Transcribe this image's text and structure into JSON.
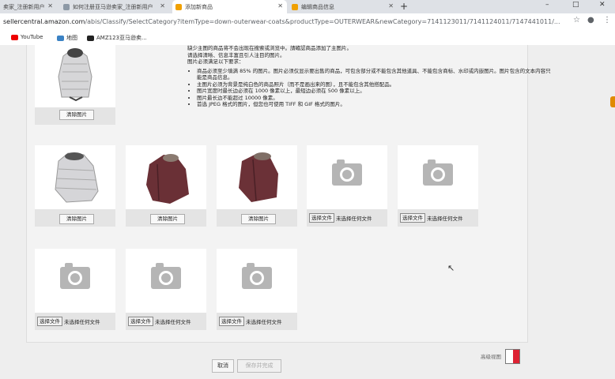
{
  "browser": {
    "tabs": [
      {
        "label": "卖家_注册新用户",
        "icon": "amazon-icon"
      },
      {
        "label": "如何注册亚马逊卖家_注册新用户",
        "icon": "doc-icon"
      },
      {
        "label": "添加新商品",
        "icon": "amazon-icon"
      },
      {
        "label": "编辑商品信息",
        "icon": "amazon-icon"
      }
    ],
    "new_tab": "+",
    "window_controls": {
      "minimize": "–",
      "maximize": "□",
      "close": "✕"
    },
    "url_host": "sellercentral.amazon.com",
    "url_path": "/abis/Classify/SelectCategory?itemType=down-outerwear-coats&productType=OUTERWEAR&newCategory=7141123011/7141124011/7147441011/..."
  },
  "bookmarks": [
    {
      "label": "YouTube",
      "icon": "youtube-icon"
    },
    {
      "label": "地图",
      "icon": "maps-icon"
    },
    {
      "label": "AMZ123亚马逊卖...",
      "icon": "amz123-icon"
    }
  ],
  "requirements": {
    "intro_lines": [
      "缺少主图的商品将不会出现在搜索或浏览中。請確認商品添加了主图片。",
      "请选择清晰、信息丰富且引人注目的图片。",
      "图片必须满足以下要求："
    ],
    "items": [
      "商品必须至少填满 85% 的图片。图片必须仅显示要出售的商品，可包含部分或不能包含其他道具、不能包含商标、水印或内嵌图片。图片包含的文本内容只能是商品信息。",
      "主图片必须为背景是纯白色的商品照片（而不是画出来的图），且不能包含其他搭配品。",
      "图片宽度时最长边必须在 1000 像素以上，最短边必须在 500 像素以上。",
      "图片最长边不能超过 10000 像素。",
      "首选 JPEG 格式的图片，但您也可使用 TIFF 和 GIF 格式的图片。"
    ]
  },
  "image_slots": {
    "clear_label": "清除图片",
    "choose_file_label": "选择文件",
    "no_file_label": "未选择任何文件"
  },
  "footer": {
    "cancel": "取消",
    "save": "保存并完成",
    "advanced_view": "高级视图"
  }
}
